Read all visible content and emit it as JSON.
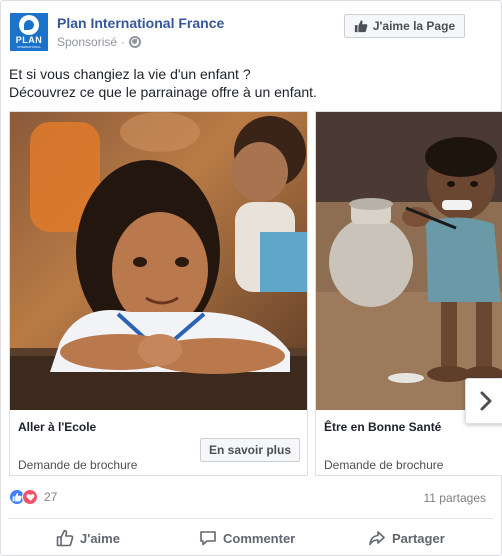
{
  "header": {
    "page_name": "Plan International France",
    "sponsored": "Sponsorisé",
    "separator": "·",
    "like_page_label": "J'aime la Page",
    "logo_text": "PLAN",
    "logo_subtext": "INTERNATIONAL"
  },
  "post": {
    "line1": "Et si vous changiez la vie d'un enfant ?",
    "line2": "Découvrez ce que le parrainage offre à un enfant."
  },
  "carousel": {
    "cards": [
      {
        "title": "Aller à l'Ecole",
        "subtitle": "Demande de brochure",
        "button": "En savoir plus"
      },
      {
        "title": "Être en Bonne Santé",
        "subtitle": "Demande de brochure"
      }
    ]
  },
  "engagement": {
    "reaction_count": "27",
    "shares": "11 partages"
  },
  "actions": {
    "like": "J'aime",
    "comment": "Commenter",
    "share": "Partager"
  },
  "icons": {
    "like": "thumbs-up-icon",
    "comment": "speech-bubble-icon",
    "share": "share-arrow-icon",
    "audience": "globe-icon",
    "next": "chevron-right-icon"
  },
  "colors": {
    "link": "#365899",
    "logo_blue": "#1a73c9",
    "like_blue": "#4080ff",
    "love_red": "#f25268"
  }
}
